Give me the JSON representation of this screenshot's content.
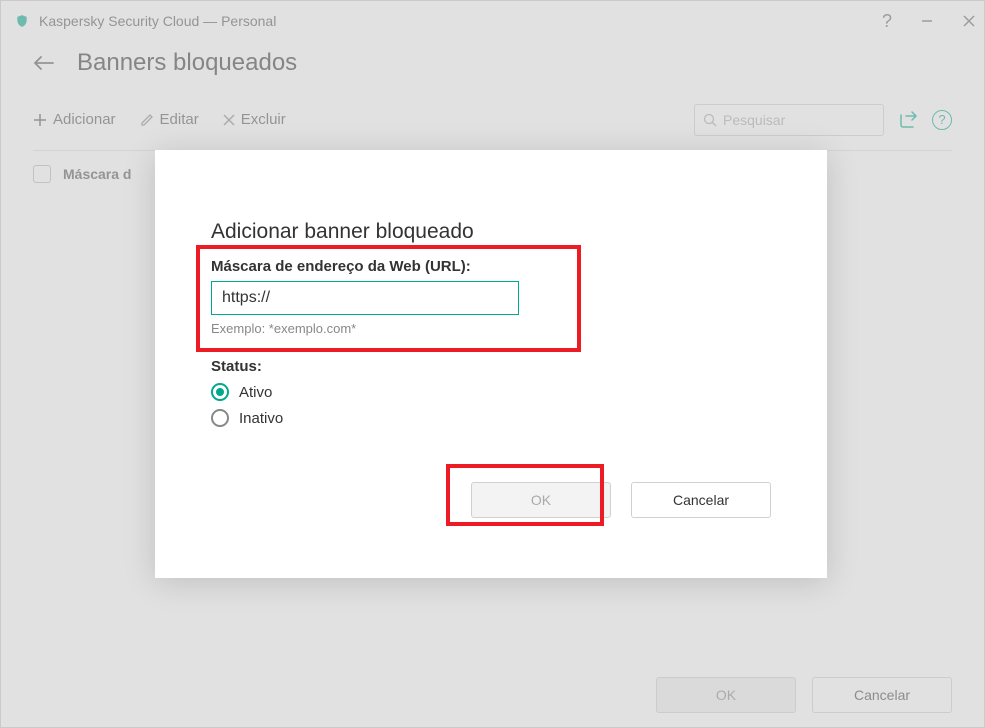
{
  "window": {
    "title": "Kaspersky Security Cloud — Personal"
  },
  "page": {
    "title": "Banners bloqueados"
  },
  "toolbar": {
    "add": "Adicionar",
    "edit": "Editar",
    "remove": "Excluir",
    "search_placeholder": "Pesquisar"
  },
  "list": {
    "column_header": "Máscara d"
  },
  "footer": {
    "ok": "OK",
    "cancel": "Cancelar"
  },
  "modal": {
    "title": "Adicionar banner bloqueado",
    "url_label": "Máscara de endereço da Web (URL):",
    "url_value": "https://",
    "url_example": "Exemplo: *exemplo.com*",
    "status_label": "Status:",
    "status_active": "Ativo",
    "status_inactive": "Inativo",
    "ok": "OK",
    "cancel": "Cancelar"
  }
}
